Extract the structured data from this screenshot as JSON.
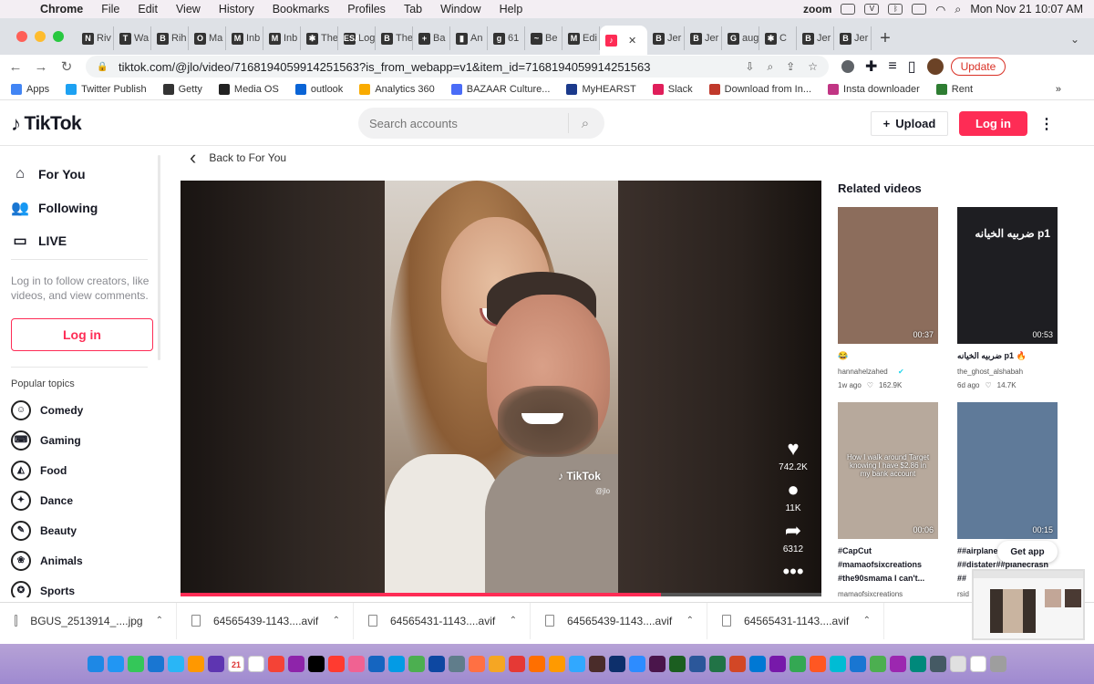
{
  "menubar": {
    "app": "Chrome",
    "items": [
      "File",
      "Edit",
      "View",
      "History",
      "Bookmarks",
      "Profiles",
      "Tab",
      "Window",
      "Help"
    ],
    "zoom": "zoom",
    "clock": "Mon Nov 21  10:07 AM"
  },
  "tabs": [
    {
      "label": "Riv",
      "icon": "N"
    },
    {
      "label": "Wa",
      "icon": "T"
    },
    {
      "label": "Rih",
      "icon": "B"
    },
    {
      "label": "Ma",
      "icon": "O"
    },
    {
      "label": "Inb",
      "icon": "M"
    },
    {
      "label": "Inb",
      "icon": "M"
    },
    {
      "label": "The",
      "icon": "✱"
    },
    {
      "label": "Log",
      "icon": "ESA"
    },
    {
      "label": "The",
      "icon": "B"
    },
    {
      "label": "Ba",
      "icon": "+"
    },
    {
      "label": "An",
      "icon": "▮"
    },
    {
      "label": "61",
      "icon": "g"
    },
    {
      "label": "Be",
      "icon": "~"
    },
    {
      "label": "Edi",
      "icon": "M"
    },
    {
      "label": "",
      "icon": "♪"
    },
    {
      "label": "Jer",
      "icon": "B"
    },
    {
      "label": "Jer",
      "icon": "B"
    },
    {
      "label": "aug",
      "icon": "G"
    },
    {
      "label": "C",
      "icon": "✱"
    },
    {
      "label": "Jer",
      "icon": "B"
    },
    {
      "label": "Jer",
      "icon": "B"
    }
  ],
  "address": {
    "url": "tiktok.com/@jlo/video/7168194059914251563?is_from_webapp=v1&item_id=7168194059914251563",
    "update_label": "Update"
  },
  "bookmarks": [
    {
      "label": "Apps",
      "color": "#4285f4"
    },
    {
      "label": "Twitter Publish",
      "color": "#1da1f2"
    },
    {
      "label": "Getty",
      "color": "#333333"
    },
    {
      "label": "Media OS",
      "color": "#222222"
    },
    {
      "label": "outlook",
      "color": "#0a64d6"
    },
    {
      "label": "Analytics 360",
      "color": "#f9ab00"
    },
    {
      "label": "BAZAAR Culture...",
      "color": "#4a6cf7"
    },
    {
      "label": "MyHEARST",
      "color": "#1b3a8c"
    },
    {
      "label": "Slack",
      "color": "#e01e5a"
    },
    {
      "label": "Download from In...",
      "color": "#c0392b"
    },
    {
      "label": "Insta downloader",
      "color": "#c13584"
    },
    {
      "label": "Rent",
      "color": "#2e7d32"
    }
  ],
  "tiktok": {
    "brand": "TikTok",
    "search_placeholder": "Search accounts",
    "upload_label": "Upload",
    "login_label": "Log in",
    "back_label": "Back to For You",
    "nav": [
      {
        "label": "For You",
        "icon": "home-icon",
        "glyph": "⌂"
      },
      {
        "label": "Following",
        "icon": "following-icon",
        "glyph": "👥"
      },
      {
        "label": "LIVE",
        "icon": "live-icon",
        "glyph": "▭"
      }
    ],
    "login_hint": "Log in to follow creators, like videos, and view comments.",
    "side_login_label": "Log in",
    "topics_title": "Popular topics",
    "topics": [
      {
        "label": "Comedy",
        "icon": "comedy-icon",
        "glyph": "☺"
      },
      {
        "label": "Gaming",
        "icon": "gaming-icon",
        "glyph": "⌨"
      },
      {
        "label": "Food",
        "icon": "food-icon",
        "glyph": "◭"
      },
      {
        "label": "Dance",
        "icon": "dance-icon",
        "glyph": "✦"
      },
      {
        "label": "Beauty",
        "icon": "beauty-icon",
        "glyph": "✎"
      },
      {
        "label": "Animals",
        "icon": "animals-icon",
        "glyph": "❀"
      },
      {
        "label": "Sports",
        "icon": "sports-icon",
        "glyph": "✪"
      }
    ],
    "video": {
      "watermark": "TikTok",
      "handle": "@jlo",
      "likes": "742.2K",
      "comments": "11K",
      "shares": "6312",
      "progress": 0.75
    },
    "related_title": "Related videos",
    "related": [
      {
        "duration": "00:37",
        "caption": "😂",
        "user": "hannahelzahed",
        "verified": true,
        "age": "1w ago",
        "likes": "162.9K",
        "bg": "#8c6d5c",
        "overlay": ""
      },
      {
        "duration": "00:53",
        "caption": "ضربيه الخيانه p1 🔥",
        "user": "the_ghost_alshabah",
        "verified": false,
        "age": "6d ago",
        "likes": "14.7K",
        "bg": "#1e1e22",
        "overlay": "ضربيه الخيانه p1"
      },
      {
        "duration": "00:06",
        "caption": "#CapCut #mamaofsixcreations #the90smama I can't...",
        "user": "mamaofsixcreations",
        "verified": false,
        "age": "",
        "likes": "",
        "bg": "#b7a99c",
        "overlay": "How I walk around Target knowing I have $2.86 in my bank account"
      },
      {
        "duration": "00:15",
        "caption": "##airplane ##distater##planecrash ##",
        "user": "rsid",
        "verified": false,
        "age": "",
        "likes": "",
        "bg": "#5f7a99",
        "overlay": ""
      }
    ],
    "get_app_label": "Get app"
  },
  "downloads": [
    {
      "name": "BGUS_2513914_....jpg"
    },
    {
      "name": "64565439-1143....avif"
    },
    {
      "name": "64565431-1143....avif"
    },
    {
      "name": "64565439-1143....avif"
    },
    {
      "name": "64565431-1143....avif"
    }
  ],
  "dock": {
    "badge": "11,659",
    "calendar_month": "NOV",
    "calendar_day": "21",
    "colors": [
      "#1e88e5",
      "#2196f3",
      "#34c759",
      "#1976d2",
      "#29b6f6",
      "#ff9800",
      "#5e35b1",
      "#ffffff",
      "#ffffff",
      "#f44336",
      "#8e24aa",
      "#000000",
      "#ff3b30",
      "#f06292",
      "#1565c0",
      "#039be5",
      "#4caf50",
      "#0d47a1",
      "#607d8b",
      "#ff7043",
      "#f5a623",
      "#e53935",
      "#ff6f00",
      "#ff9a00",
      "#31a8ff",
      "#4a2c2a",
      "#0d2f6b",
      "#2d8cff",
      "#4a154b",
      "#1b5e20",
      "#2b579a",
      "#217346",
      "#d24726",
      "#0078d4",
      "#7719aa",
      "#34a853",
      "#ff5722",
      "#00bcd4",
      "#1976d2",
      "#4caf50",
      "#9c27b0",
      "#00897b",
      "#455a64",
      "#e0e0e0",
      "#ffffff",
      "#9e9e9e"
    ]
  }
}
